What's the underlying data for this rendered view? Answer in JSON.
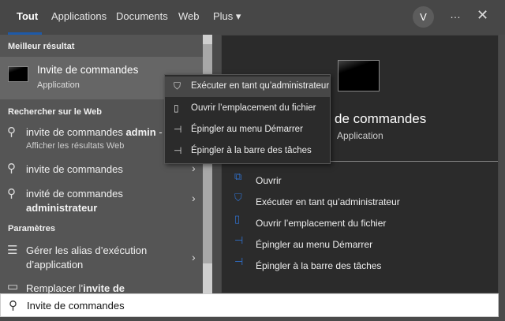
{
  "tabs": [
    {
      "label": "Tout",
      "active": true
    },
    {
      "label": "Applications"
    },
    {
      "label": "Documents"
    },
    {
      "label": "Web"
    },
    {
      "label": "Plus ▾"
    }
  ],
  "header": {
    "avatar": "V",
    "more_icon": "…",
    "close_icon": "✕"
  },
  "left": {
    "best_header": "Meilleur résultat",
    "best": {
      "title": "Invite de commandes",
      "subtitle": "Application"
    },
    "web_header": "Rechercher sur le Web",
    "web": [
      {
        "text": "invite de commandes ",
        "bold": "admin",
        "suffix": " -",
        "sub": "Afficher les résultats Web"
      },
      {
        "text": "invite de commandes"
      },
      {
        "text": "invité de commandes",
        "line2": "administrateur"
      }
    ],
    "settings_header": "Paramètres",
    "settings": [
      {
        "text": "Gérer les alias d’exécution",
        "line2": "d’application"
      },
      {
        "text": "Remplacer l’",
        "bold": "invite de"
      }
    ]
  },
  "right": {
    "title": "de commandes",
    "subtitle": "Application",
    "actions": [
      "Ouvrir",
      "Exécuter en tant qu’administrateur",
      "Ouvrir l’emplacement du fichier",
      "Épingler au menu Démarrer",
      "Épingler à la barre des tâches"
    ]
  },
  "context_menu": [
    "Exécuter en tant qu’administrateur",
    "Ouvrir l’emplacement du fichier",
    "Épingler au menu Démarrer",
    "Épingler à la barre des tâches"
  ],
  "search": {
    "value": "Invite de commandes"
  },
  "colors": {
    "accent": "#1e5aa8",
    "action_icon": "#2f6fc9"
  }
}
